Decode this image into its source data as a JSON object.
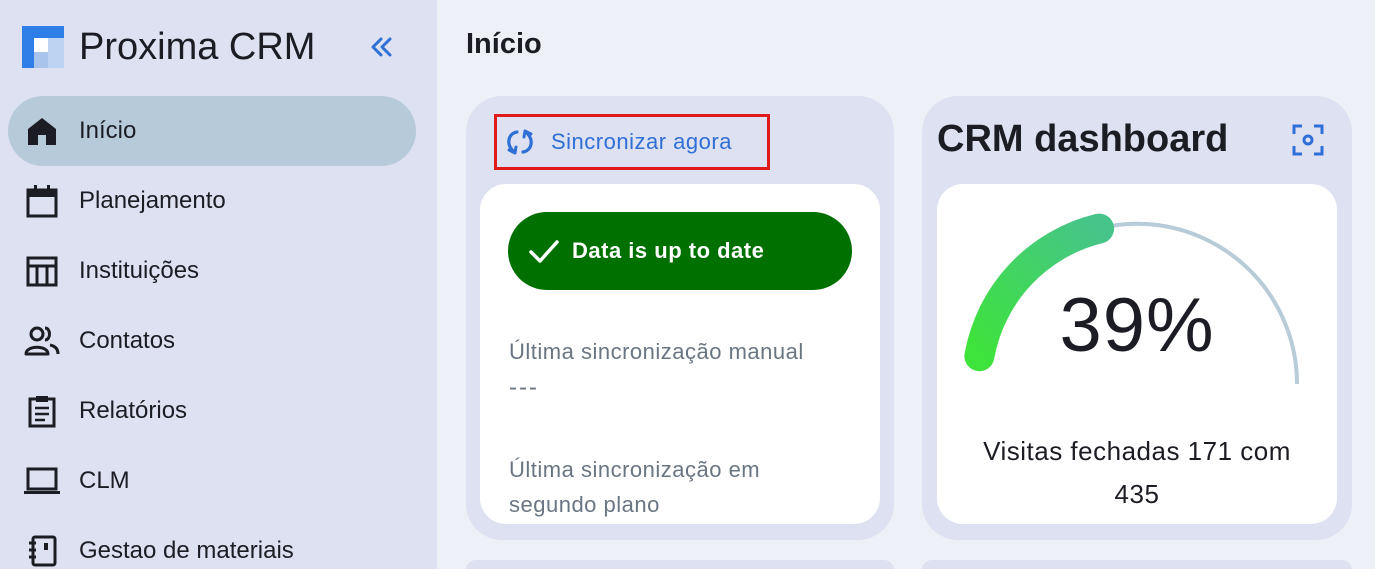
{
  "sidebar": {
    "brand": "Proxima CRM",
    "items": [
      {
        "label": "Início",
        "icon": "home-icon",
        "active": true
      },
      {
        "label": "Planejamento",
        "icon": "calendar-icon",
        "active": false
      },
      {
        "label": "Instituições",
        "icon": "institution-icon",
        "active": false
      },
      {
        "label": "Contatos",
        "icon": "contacts-icon",
        "active": false
      },
      {
        "label": "Relatórios",
        "icon": "report-icon",
        "active": false
      },
      {
        "label": "CLM",
        "icon": "laptop-icon",
        "active": false
      },
      {
        "label": "Gestao de materiais",
        "icon": "notebook-icon",
        "active": false
      }
    ]
  },
  "main": {
    "page_title": "Início",
    "sync_card": {
      "sync_label": "Sincronizar agora",
      "status_label": "Data is up to date",
      "last_manual_label": "Última sincronização manual",
      "last_manual_value": "---",
      "last_background_label": "Última sincronização em segundo plano"
    },
    "crm_card": {
      "title": "CRM dashboard",
      "percent_label": "39%",
      "percent_value": 39,
      "visits_text": "Visitas fechadas 171 com 435"
    }
  },
  "colors": {
    "accent": "#2f6fd6",
    "status_green": "#007100",
    "highlight_red": "#e01a1a",
    "gauge_start": "#3ee33b",
    "gauge_end": "#46c48a",
    "gauge_track": "#b7cbd9"
  }
}
